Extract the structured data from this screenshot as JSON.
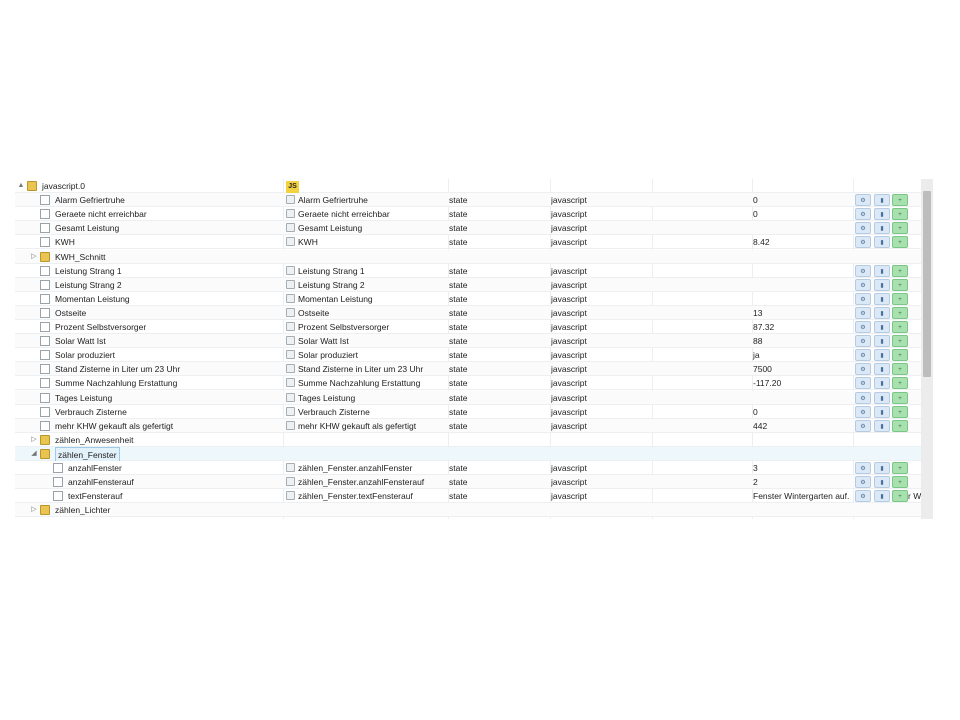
{
  "header": {
    "js_badge": "JS"
  },
  "rows": [
    {
      "indent": 0,
      "kind": "folder",
      "expander": "▲",
      "name": "javascript.0",
      "title": "",
      "type": "",
      "role": "",
      "value": "",
      "buttons": false,
      "js": true
    },
    {
      "indent": 1,
      "kind": "file",
      "name": "Alarm Gefriertruhe",
      "title": "Alarm Gefriertruhe",
      "type": "state",
      "role": "javascript",
      "value": "0",
      "buttons": true
    },
    {
      "indent": 1,
      "kind": "file",
      "name": "Geraete nicht erreichbar",
      "title": "Geraete nicht erreichbar",
      "type": "state",
      "role": "javascript",
      "value": "0",
      "buttons": true
    },
    {
      "indent": 1,
      "kind": "file",
      "name": "Gesamt Leistung",
      "title": "Gesamt Leistung",
      "type": "state",
      "role": "javascript",
      "value": "",
      "buttons": true
    },
    {
      "indent": 1,
      "kind": "file",
      "name": "KWH",
      "title": "KWH",
      "type": "state",
      "role": "javascript",
      "value": "8.42",
      "buttons": true
    },
    {
      "indent": 1,
      "kind": "folder",
      "expander": "▷",
      "name": "KWH_Schnitt",
      "title": "",
      "type": "",
      "role": "",
      "value": "",
      "buttons": false
    },
    {
      "indent": 1,
      "kind": "file",
      "name": "Leistung Strang 1",
      "title": "Leistung Strang 1",
      "type": "state",
      "role": "javascript",
      "value": "",
      "buttons": true
    },
    {
      "indent": 1,
      "kind": "file",
      "name": "Leistung Strang 2",
      "title": "Leistung Strang 2",
      "type": "state",
      "role": "javascript",
      "value": "",
      "buttons": true
    },
    {
      "indent": 1,
      "kind": "file",
      "name": "Momentan Leistung",
      "title": "Momentan Leistung",
      "type": "state",
      "role": "javascript",
      "value": "",
      "buttons": true
    },
    {
      "indent": 1,
      "kind": "file",
      "name": "Ostseite",
      "title": "Ostseite",
      "type": "state",
      "role": "javascript",
      "value": "13",
      "buttons": true
    },
    {
      "indent": 1,
      "kind": "file",
      "name": "Prozent Selbstversorger",
      "title": "Prozent Selbstversorger",
      "type": "state",
      "role": "javascript",
      "value": "87.32",
      "buttons": true
    },
    {
      "indent": 1,
      "kind": "file",
      "name": "Solar Watt Ist",
      "title": "Solar Watt Ist",
      "type": "state",
      "role": "javascript",
      "value": "88",
      "buttons": true
    },
    {
      "indent": 1,
      "kind": "file",
      "name": "Solar produziert",
      "title": "Solar produziert",
      "type": "state",
      "role": "javascript",
      "value": "ja",
      "buttons": true
    },
    {
      "indent": 1,
      "kind": "file",
      "name": "Stand Zisterne in Liter um 23 Uhr",
      "title": "Stand Zisterne in Liter um 23 Uhr",
      "type": "state",
      "role": "javascript",
      "value": "7500",
      "buttons": true
    },
    {
      "indent": 1,
      "kind": "file",
      "name": "Summe Nachzahlung Erstattung",
      "title": "Summe Nachzahlung Erstattung",
      "type": "state",
      "role": "javascript",
      "value": "-117.20",
      "buttons": true
    },
    {
      "indent": 1,
      "kind": "file",
      "name": "Tages Leistung",
      "title": "Tages Leistung",
      "type": "state",
      "role": "javascript",
      "value": "",
      "buttons": true
    },
    {
      "indent": 1,
      "kind": "file",
      "name": "Verbrauch Zisterne",
      "title": "Verbrauch Zisterne",
      "type": "state",
      "role": "javascript",
      "value": "0",
      "buttons": true
    },
    {
      "indent": 1,
      "kind": "file",
      "name": "mehr KHW gekauft als gefertigt",
      "title": "mehr KHW gekauft als gefertigt",
      "type": "state",
      "role": "javascript",
      "value": "442",
      "buttons": true
    },
    {
      "indent": 1,
      "kind": "folder",
      "expander": "▷",
      "name": "zählen_Anwesenheit",
      "title": "",
      "type": "",
      "role": "",
      "value": "",
      "buttons": false
    },
    {
      "indent": 1,
      "kind": "folder",
      "expander": "◢",
      "name": "zählen_Fenster",
      "title": "",
      "type": "",
      "role": "",
      "value": "",
      "buttons": false,
      "selected": true
    },
    {
      "indent": 2,
      "kind": "file",
      "name": "anzahlFenster",
      "title": "zählen_Fenster.anzahlFenster",
      "type": "state",
      "role": "javascript",
      "value": "3",
      "buttons": true
    },
    {
      "indent": 2,
      "kind": "file",
      "name": "anzahlFensterauf",
      "title": "zählen_Fenster.anzahlFensterauf",
      "type": "state",
      "role": "javascript",
      "value": "2",
      "buttons": true
    },
    {
      "indent": 2,
      "kind": "file",
      "name": "textFensterauf",
      "title": "zählen_Fenster.textFensterauf",
      "type": "state",
      "role": "javascript",
      "value": "Fenster Wintergarten auf.",
      "value_overflow": "r W",
      "buttons": true
    },
    {
      "indent": 1,
      "kind": "folder",
      "expander": "▷",
      "name": "zählen_Lichter",
      "title": "",
      "type": "",
      "role": "",
      "value": "",
      "buttons": false
    }
  ],
  "colors": {
    "folder": "#e9c451",
    "js_badge": "#f3d23f",
    "add_button": "#a8e0b0",
    "edit_button": "#dbe8f6",
    "selected_row": "#eef7fc"
  },
  "icons": {
    "edit": "gear-icon",
    "delete": "trash-icon",
    "add": "plus-icon",
    "folder": "folder-icon",
    "file": "file-icon"
  }
}
